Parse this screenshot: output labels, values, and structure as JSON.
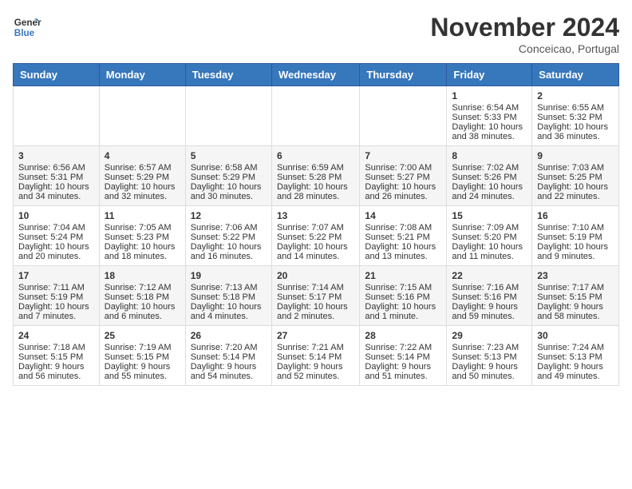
{
  "header": {
    "logo_line1": "General",
    "logo_line2": "Blue",
    "month_title": "November 2024",
    "location": "Conceicao, Portugal"
  },
  "weekdays": [
    "Sunday",
    "Monday",
    "Tuesday",
    "Wednesday",
    "Thursday",
    "Friday",
    "Saturday"
  ],
  "weeks": [
    [
      {
        "day": "",
        "sunrise": "",
        "sunset": "",
        "daylight": ""
      },
      {
        "day": "",
        "sunrise": "",
        "sunset": "",
        "daylight": ""
      },
      {
        "day": "",
        "sunrise": "",
        "sunset": "",
        "daylight": ""
      },
      {
        "day": "",
        "sunrise": "",
        "sunset": "",
        "daylight": ""
      },
      {
        "day": "",
        "sunrise": "",
        "sunset": "",
        "daylight": ""
      },
      {
        "day": "1",
        "sunrise": "Sunrise: 6:54 AM",
        "sunset": "Sunset: 5:33 PM",
        "daylight": "Daylight: 10 hours and 38 minutes."
      },
      {
        "day": "2",
        "sunrise": "Sunrise: 6:55 AM",
        "sunset": "Sunset: 5:32 PM",
        "daylight": "Daylight: 10 hours and 36 minutes."
      }
    ],
    [
      {
        "day": "3",
        "sunrise": "Sunrise: 6:56 AM",
        "sunset": "Sunset: 5:31 PM",
        "daylight": "Daylight: 10 hours and 34 minutes."
      },
      {
        "day": "4",
        "sunrise": "Sunrise: 6:57 AM",
        "sunset": "Sunset: 5:29 PM",
        "daylight": "Daylight: 10 hours and 32 minutes."
      },
      {
        "day": "5",
        "sunrise": "Sunrise: 6:58 AM",
        "sunset": "Sunset: 5:29 PM",
        "daylight": "Daylight: 10 hours and 30 minutes."
      },
      {
        "day": "6",
        "sunrise": "Sunrise: 6:59 AM",
        "sunset": "Sunset: 5:28 PM",
        "daylight": "Daylight: 10 hours and 28 minutes."
      },
      {
        "day": "7",
        "sunrise": "Sunrise: 7:00 AM",
        "sunset": "Sunset: 5:27 PM",
        "daylight": "Daylight: 10 hours and 26 minutes."
      },
      {
        "day": "8",
        "sunrise": "Sunrise: 7:02 AM",
        "sunset": "Sunset: 5:26 PM",
        "daylight": "Daylight: 10 hours and 24 minutes."
      },
      {
        "day": "9",
        "sunrise": "Sunrise: 7:03 AM",
        "sunset": "Sunset: 5:25 PM",
        "daylight": "Daylight: 10 hours and 22 minutes."
      }
    ],
    [
      {
        "day": "10",
        "sunrise": "Sunrise: 7:04 AM",
        "sunset": "Sunset: 5:24 PM",
        "daylight": "Daylight: 10 hours and 20 minutes."
      },
      {
        "day": "11",
        "sunrise": "Sunrise: 7:05 AM",
        "sunset": "Sunset: 5:23 PM",
        "daylight": "Daylight: 10 hours and 18 minutes."
      },
      {
        "day": "12",
        "sunrise": "Sunrise: 7:06 AM",
        "sunset": "Sunset: 5:22 PM",
        "daylight": "Daylight: 10 hours and 16 minutes."
      },
      {
        "day": "13",
        "sunrise": "Sunrise: 7:07 AM",
        "sunset": "Sunset: 5:22 PM",
        "daylight": "Daylight: 10 hours and 14 minutes."
      },
      {
        "day": "14",
        "sunrise": "Sunrise: 7:08 AM",
        "sunset": "Sunset: 5:21 PM",
        "daylight": "Daylight: 10 hours and 13 minutes."
      },
      {
        "day": "15",
        "sunrise": "Sunrise: 7:09 AM",
        "sunset": "Sunset: 5:20 PM",
        "daylight": "Daylight: 10 hours and 11 minutes."
      },
      {
        "day": "16",
        "sunrise": "Sunrise: 7:10 AM",
        "sunset": "Sunset: 5:19 PM",
        "daylight": "Daylight: 10 hours and 9 minutes."
      }
    ],
    [
      {
        "day": "17",
        "sunrise": "Sunrise: 7:11 AM",
        "sunset": "Sunset: 5:19 PM",
        "daylight": "Daylight: 10 hours and 7 minutes."
      },
      {
        "day": "18",
        "sunrise": "Sunrise: 7:12 AM",
        "sunset": "Sunset: 5:18 PM",
        "daylight": "Daylight: 10 hours and 6 minutes."
      },
      {
        "day": "19",
        "sunrise": "Sunrise: 7:13 AM",
        "sunset": "Sunset: 5:18 PM",
        "daylight": "Daylight: 10 hours and 4 minutes."
      },
      {
        "day": "20",
        "sunrise": "Sunrise: 7:14 AM",
        "sunset": "Sunset: 5:17 PM",
        "daylight": "Daylight: 10 hours and 2 minutes."
      },
      {
        "day": "21",
        "sunrise": "Sunrise: 7:15 AM",
        "sunset": "Sunset: 5:16 PM",
        "daylight": "Daylight: 10 hours and 1 minute."
      },
      {
        "day": "22",
        "sunrise": "Sunrise: 7:16 AM",
        "sunset": "Sunset: 5:16 PM",
        "daylight": "Daylight: 9 hours and 59 minutes."
      },
      {
        "day": "23",
        "sunrise": "Sunrise: 7:17 AM",
        "sunset": "Sunset: 5:15 PM",
        "daylight": "Daylight: 9 hours and 58 minutes."
      }
    ],
    [
      {
        "day": "24",
        "sunrise": "Sunrise: 7:18 AM",
        "sunset": "Sunset: 5:15 PM",
        "daylight": "Daylight: 9 hours and 56 minutes."
      },
      {
        "day": "25",
        "sunrise": "Sunrise: 7:19 AM",
        "sunset": "Sunset: 5:15 PM",
        "daylight": "Daylight: 9 hours and 55 minutes."
      },
      {
        "day": "26",
        "sunrise": "Sunrise: 7:20 AM",
        "sunset": "Sunset: 5:14 PM",
        "daylight": "Daylight: 9 hours and 54 minutes."
      },
      {
        "day": "27",
        "sunrise": "Sunrise: 7:21 AM",
        "sunset": "Sunset: 5:14 PM",
        "daylight": "Daylight: 9 hours and 52 minutes."
      },
      {
        "day": "28",
        "sunrise": "Sunrise: 7:22 AM",
        "sunset": "Sunset: 5:14 PM",
        "daylight": "Daylight: 9 hours and 51 minutes."
      },
      {
        "day": "29",
        "sunrise": "Sunrise: 7:23 AM",
        "sunset": "Sunset: 5:13 PM",
        "daylight": "Daylight: 9 hours and 50 minutes."
      },
      {
        "day": "30",
        "sunrise": "Sunrise: 7:24 AM",
        "sunset": "Sunset: 5:13 PM",
        "daylight": "Daylight: 9 hours and 49 minutes."
      }
    ]
  ]
}
